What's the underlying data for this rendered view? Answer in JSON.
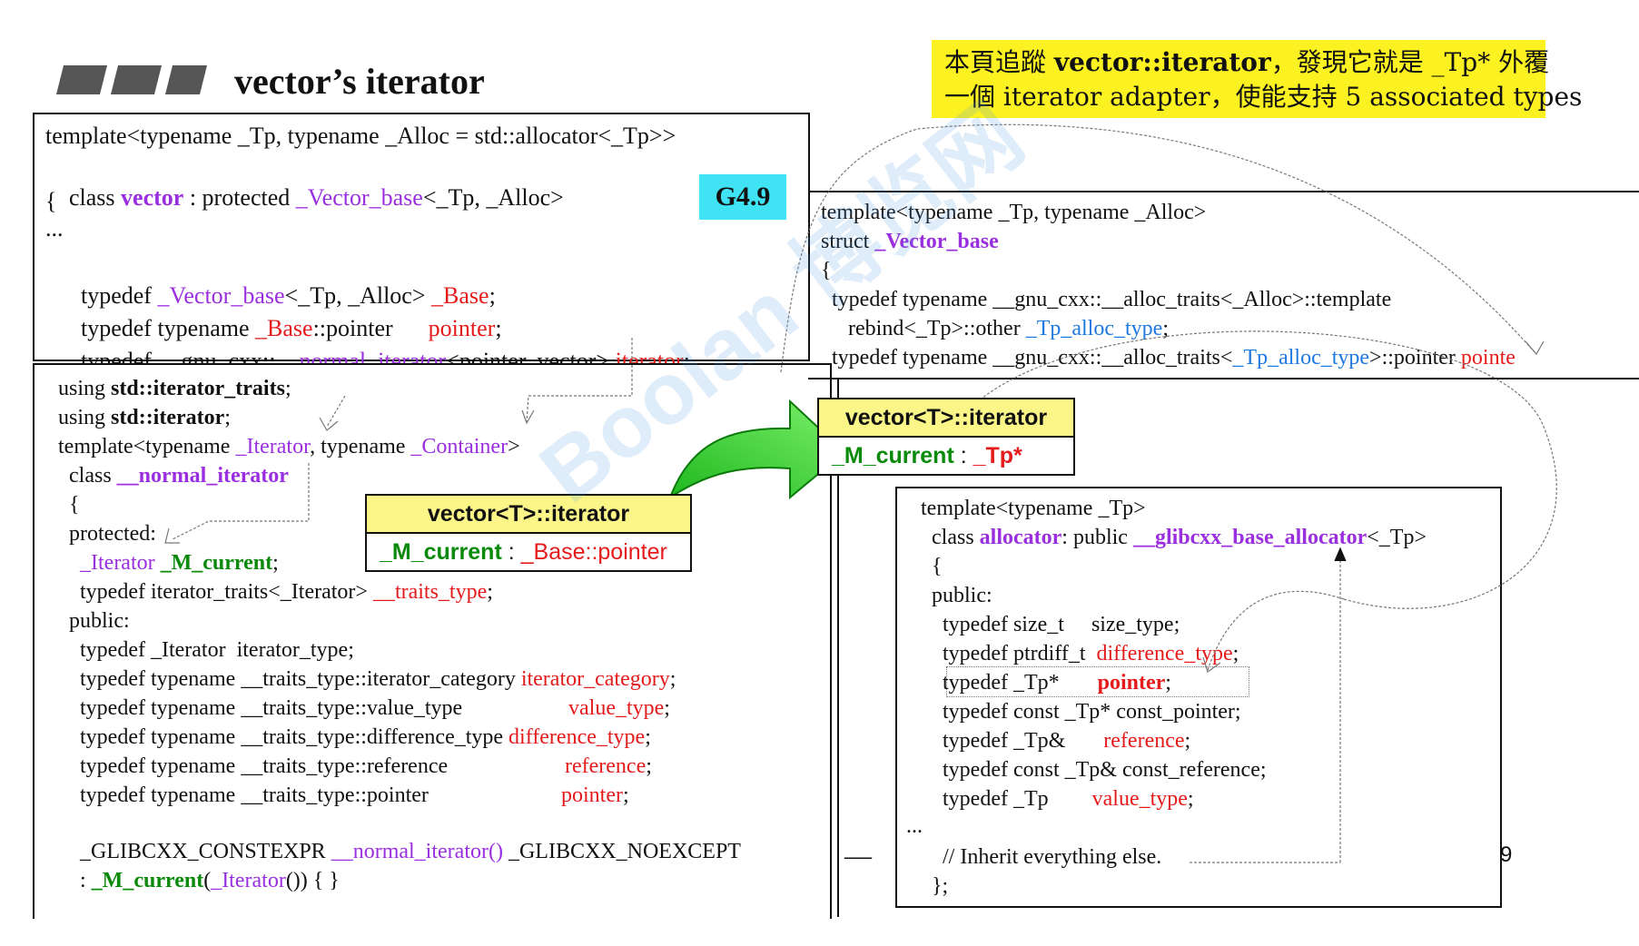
{
  "title": "vector’s iterator",
  "note": {
    "line1_a": "本頁追蹤 ",
    "line1_b": "vector::iterator",
    "line1_c": "，發現它就是 _Tp* 外覆",
    "line2": "一個 iterator adapter，使能支持 5 associated types"
  },
  "version_badge": "G4.9",
  "page_number": "9",
  "dash": "—",
  "vector_decl": {
    "l1": "template<typename _Tp, typename _Alloc = std::allocator<_Tp>>",
    "l2_a": "class ",
    "l2_b": "vector",
    "l2_c": " : protected ",
    "l2_d": "_Vector_base",
    "l2_e": "<_Tp, _Alloc>",
    "l3": "{",
    "l4": "...",
    "l5_a": "  typedef ",
    "l5_b": "_Vector_base",
    "l5_c": "<_Tp, _Alloc> ",
    "l5_d": "_Base",
    "l5_e": ";",
    "l6_a": "  typedef typename ",
    "l6_b": "_Base",
    "l6_c": "::pointer      ",
    "l6_d": "pointer",
    "l6_e": ";",
    "l7_a": "  typedef __gnu_cxx::",
    "l7_b": "__normal_iterator",
    "l7_c": "<pointer, vector> ",
    "l7_d": "iterator",
    "l7_e": ";"
  },
  "normal_iterator": {
    "l1_a": "using ",
    "l1_b": "std::iterator_traits",
    "l1_c": ";",
    "l2_a": "using ",
    "l2_b": "std::iterator",
    "l2_c": ";",
    "l3_a": "template<typename ",
    "l3_b": "_Iterator",
    "l3_c": ", typename ",
    "l3_d": "_Container",
    "l3_e": ">",
    "l4_a": "  class ",
    "l4_b": "__normal_iterator",
    "l5": "  {",
    "l6": "  protected:",
    "l7_a": "    ",
    "l7_b": "_Iterator",
    "l7_c": " ",
    "l7_d": "_M_current",
    "l7_e": ";",
    "l8_a": "    typedef iterator_traits<_Iterator> ",
    "l8_b": "__traits_type",
    "l8_c": ";",
    "l9": "  public:",
    "l10": "    typedef _Iterator  iterator_type;",
    "l11_a": "    typedef typename __traits_type::iterator_category ",
    "l11_b": "iterator_category",
    "l11_c": ";",
    "l12_a": "    typedef typename __traits_type::value_type",
    "l12_b": "value_type",
    "l12_c": ";",
    "l13_a": "    typedef typename __traits_type::difference_type ",
    "l13_b": "difference_type",
    "l13_c": ";",
    "l14_a": "    typedef typename __traits_type::reference",
    "l14_b": "reference",
    "l14_c": ";",
    "l15_a": "    typedef typename __traits_type::pointer",
    "l15_b": "pointer",
    "l15_c": ";",
    "l16_a": "    _GLIBCXX_CONSTEXPR ",
    "l16_b": "__normal_iterator()",
    "l16_c": " _GLIBCXX_NOEXCEPT",
    "l17_a": "    : ",
    "l17_b": "_M_current",
    "l17_c": "(",
    "l17_d": "_Iterator",
    "l17_e": "()) { }"
  },
  "vector_base": {
    "l1": "template<typename _Tp, typename _Alloc>",
    "l2_a": "struct ",
    "l2_b": "_Vector_base",
    "l3": "{",
    "l4": "  typedef typename __gnu_cxx::__alloc_traits<_Alloc>::template",
    "l5_a": "     rebind<_Tp>::other ",
    "l5_b": "_Tp_alloc_type",
    "l5_c": ";",
    "l6_a": "  typedef typename __gnu_cxx::__alloc_traits<",
    "l6_b": "_Tp_alloc_type",
    "l6_c": ">::pointer ",
    "l6_d": "pointe"
  },
  "allocator": {
    "l1": "template<typename _Tp>",
    "l2_a": "  class ",
    "l2_b": "allocator",
    "l2_c": ": public ",
    "l2_d": "__glibcxx_base_allocator",
    "l2_e": "<_Tp>",
    "l3": "  {",
    "l4": "  public:",
    "l5": "    typedef size_t     size_type;",
    "l6_a": "    typedef ptrdiff_t  ",
    "l6_b": "difference_type",
    "l6_c": ";",
    "l7_a": "    typedef _Tp*       ",
    "l7_b": "pointer",
    "l7_c": ";",
    "l8": "    typedef const _Tp* const_pointer;",
    "l9_a": "    typedef _Tp&       ",
    "l9_b": "reference",
    "l9_c": ";",
    "l10": "    typedef const _Tp& const_reference;",
    "l11_a": "    typedef _Tp        ",
    "l11_b": "value_type",
    "l11_c": ";",
    "l12": "...",
    "l13": "    // Inherit everything else.",
    "l14": "  };"
  },
  "box_mid": {
    "head": "vector<T>::iterator",
    "body_a": "_M_current",
    "body_b": " : ",
    "body_c": "_Base",
    "body_d": "::pointer"
  },
  "box_right": {
    "head": "vector<T>::iterator",
    "body_a": "_M_current",
    "body_b": " : ",
    "body_c": "_Tp*"
  },
  "watermark": "Boolan 博览网",
  "colors": {
    "purple": "#9a2fe0",
    "red": "#e51b1b",
    "blue": "#1e78e0",
    "green": "#0a8a0a",
    "note_bg": "#fcf221",
    "badge_bg": "#3fe3f4",
    "box_head": "#fcf689"
  }
}
